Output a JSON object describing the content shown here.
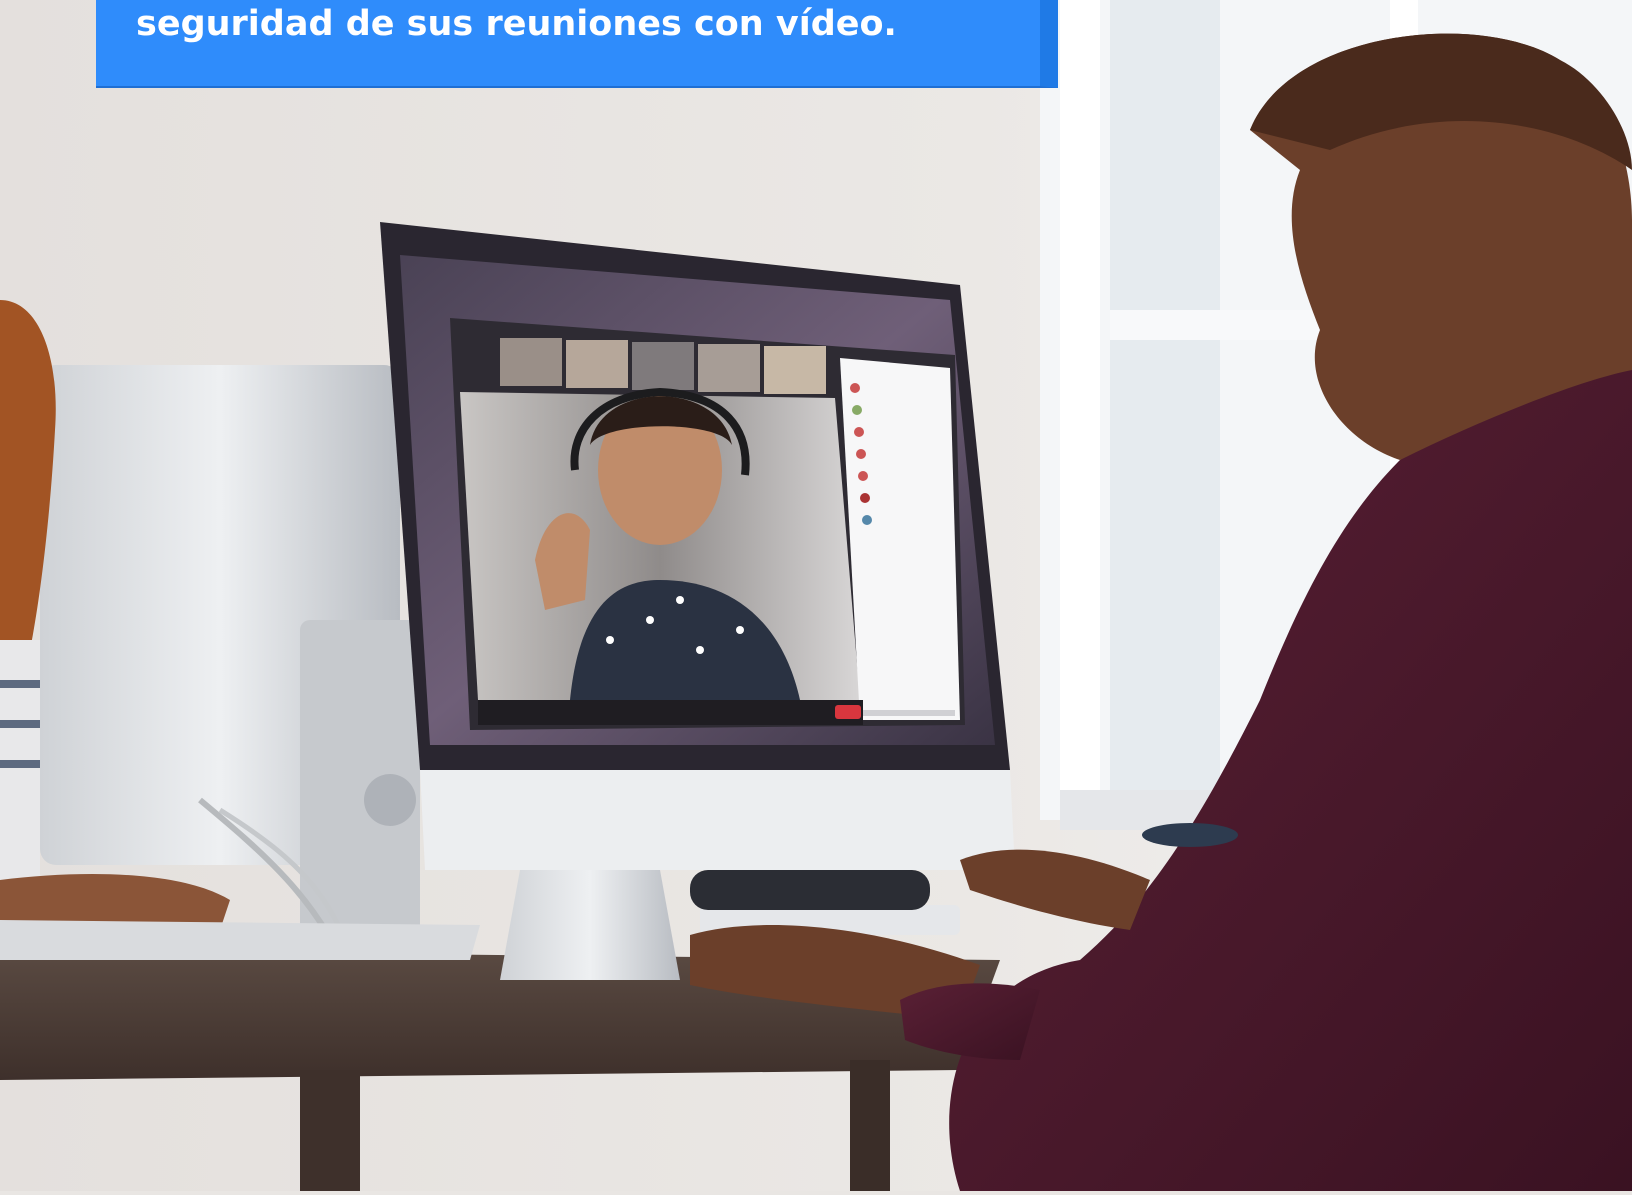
{
  "banner": {
    "text": "seguridad de sus reuniones con vídeo.",
    "background": "#2f8cfb"
  },
  "photo": {
    "subject": "video-conference-photo",
    "colors": {
      "wall": "#e9e6e3",
      "window": "#f4f6f8",
      "sweater": "#4a1a2a",
      "skin": "#6b3f2a",
      "desk": "#4b3a33",
      "imac_bezel": "#2a2630",
      "imac_chin": "#e9eaec",
      "conference_bg": "#3b3540"
    }
  }
}
